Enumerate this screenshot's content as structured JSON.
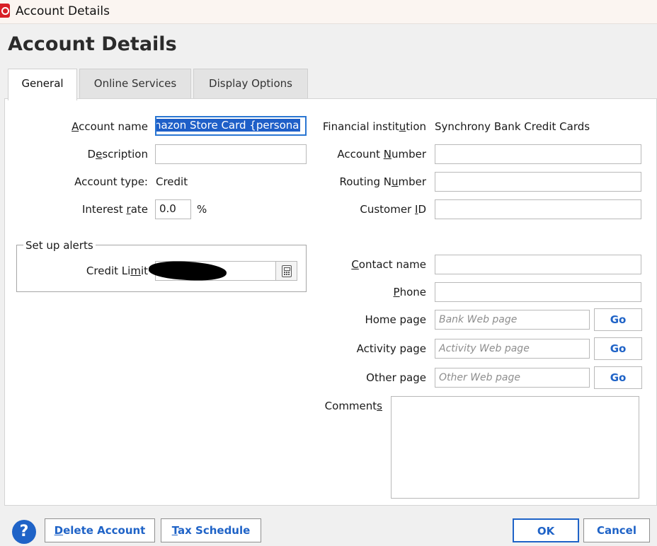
{
  "window": {
    "title": "Account Details"
  },
  "page": {
    "title": "Account Details"
  },
  "tabs": [
    {
      "label": "General"
    },
    {
      "label": "Online Services"
    },
    {
      "label": "Display Options"
    }
  ],
  "left": {
    "account_name": {
      "label": "Account name",
      "value": "nazon Store Card {persona"
    },
    "description": {
      "label": "Description",
      "value": ""
    },
    "account_type": {
      "label": "Account type:",
      "value": "Credit"
    },
    "interest_rate": {
      "label": "Interest rate",
      "value": "0.0",
      "unit": "%"
    },
    "alerts": {
      "legend": "Set up alerts",
      "credit_limit_label": "Credit Limit"
    }
  },
  "right": {
    "financial_institution": {
      "label": "Financial institution",
      "value": "Synchrony Bank Credit Cards"
    },
    "account_number": {
      "label": "Account Number",
      "value": ""
    },
    "routing_number": {
      "label": "Routing Number",
      "value": ""
    },
    "customer_id": {
      "label": "Customer ID",
      "value": ""
    },
    "contact_name": {
      "label": "Contact name",
      "value": ""
    },
    "phone": {
      "label": "Phone",
      "value": ""
    },
    "home_page": {
      "label": "Home page",
      "placeholder": "Bank Web page",
      "go": "Go"
    },
    "activity_page": {
      "label": "Activity page",
      "placeholder": "Activity Web page",
      "go": "Go"
    },
    "other_page": {
      "label": "Other page",
      "placeholder": "Other Web page",
      "go": "Go"
    },
    "comments": {
      "label": "Comments"
    }
  },
  "footer": {
    "help": "?",
    "delete_account": "Delete Account",
    "tax_schedule": "Tax Schedule",
    "ok": "OK",
    "cancel": "Cancel"
  },
  "colors": {
    "accent": "#1f63c7",
    "brand_red": "#d81f26",
    "selection": "#1e5fc8"
  },
  "icons": [
    "app-logo-icon",
    "calculator-icon",
    "help-icon"
  ]
}
